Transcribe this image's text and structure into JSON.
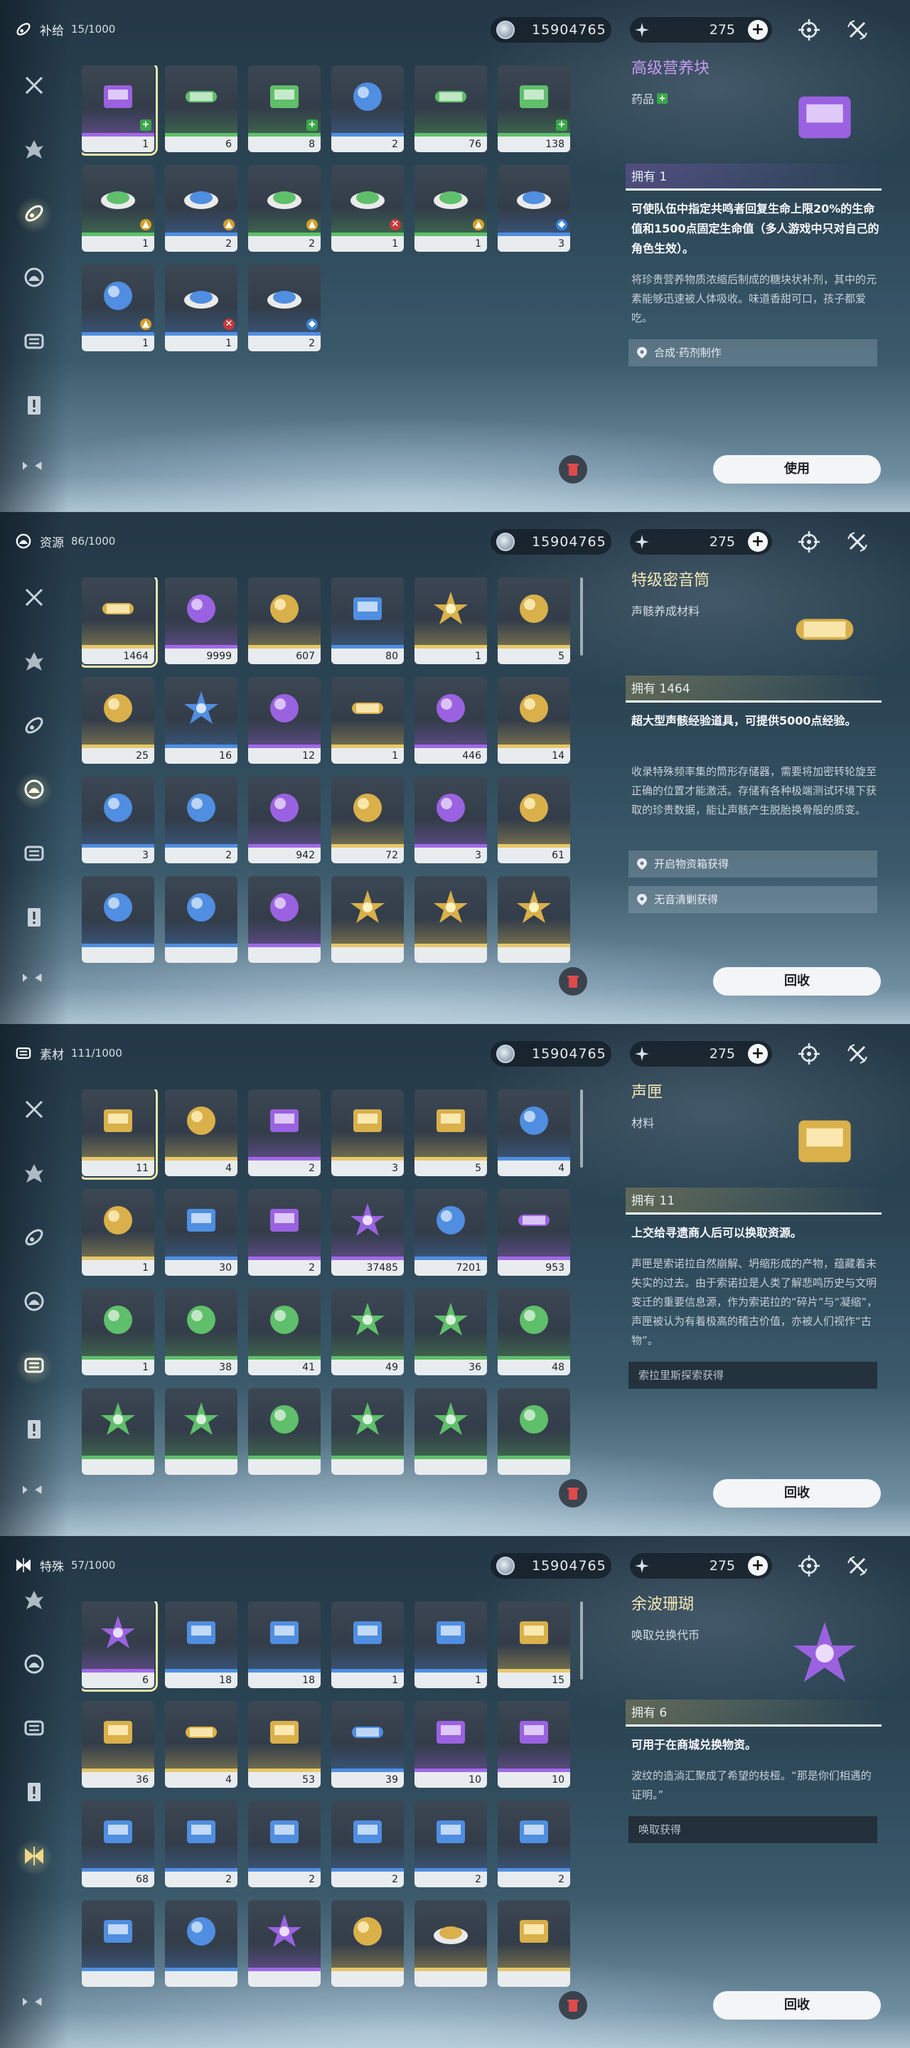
{
  "colors": {
    "accent_gold": "#f0e6a8",
    "rarity_green": "#5fbf6a",
    "rarity_blue": "#4f8ee0",
    "rarity_purple": "#a06ae6",
    "rarity_gold": "#e6c86a"
  },
  "panels": [
    {
      "category": "补给",
      "count": "15/1000",
      "currency": "15904765",
      "energy": "275",
      "items": [
        {
          "count": "1",
          "rarity": "purple",
          "badge": "heal",
          "icon": "nutrition-block-icon"
        },
        {
          "count": "6",
          "rarity": "green",
          "badge": "",
          "icon": "spray-canister-icon"
        },
        {
          "count": "8",
          "rarity": "green",
          "badge": "heal",
          "icon": "nutrition-block-icon"
        },
        {
          "count": "2",
          "rarity": "blue",
          "badge": "",
          "icon": "supply-bag-icon"
        },
        {
          "count": "76",
          "rarity": "green",
          "badge": "",
          "icon": "spray-canister-icon"
        },
        {
          "count": "138",
          "rarity": "green",
          "badge": "heal",
          "icon": "nutrition-block-icon"
        },
        {
          "count": "1",
          "rarity": "green",
          "badge": "buff",
          "icon": "dish-icon"
        },
        {
          "count": "2",
          "rarity": "blue",
          "badge": "buff",
          "icon": "skewer-icon"
        },
        {
          "count": "2",
          "rarity": "green",
          "badge": "buff",
          "icon": "soup-bowl-icon"
        },
        {
          "count": "1",
          "rarity": "green",
          "badge": "atk",
          "icon": "roast-icon"
        },
        {
          "count": "1",
          "rarity": "green",
          "badge": "buff",
          "icon": "fried-rice-icon"
        },
        {
          "count": "3",
          "rarity": "blue",
          "badge": "def",
          "icon": "pizza-icon"
        },
        {
          "count": "1",
          "rarity": "blue",
          "badge": "buff",
          "icon": "ice-cream-icon"
        },
        {
          "count": "1",
          "rarity": "blue",
          "badge": "atk",
          "icon": "sandwich-icon"
        },
        {
          "count": "2",
          "rarity": "blue",
          "badge": "def",
          "icon": "pastry-icon"
        }
      ],
      "detail": {
        "title": "高级营养块",
        "type": "药品",
        "own": "拥有 1",
        "desc": "可使队伍中指定共鸣者回复生命上限20%的生命值和1500点固定生命值（多人游戏中只对自己的角色生效）。",
        "lore": "将珍贵营养物质浓缩后制成的糖块状补剂，其中的元素能够迅速被人体吸收。味道香甜可口，孩子都爱吃。",
        "sources": [
          "合成·药剂制作"
        ],
        "button": "使用"
      }
    },
    {
      "category": "资源",
      "count": "86/1000",
      "currency": "15904765",
      "energy": "275",
      "items": [
        {
          "count": "1464",
          "rarity": "gold",
          "icon": "sonance-canister-icon"
        },
        {
          "count": "9999",
          "rarity": "purple",
          "icon": "cube-crystal-icon"
        },
        {
          "count": "607",
          "rarity": "gold",
          "icon": "cube-crystal-icon"
        },
        {
          "count": "80",
          "rarity": "blue",
          "icon": "device-icon"
        },
        {
          "count": "1",
          "rarity": "gold",
          "icon": "star-shard-icon"
        },
        {
          "count": "5",
          "rarity": "gold",
          "icon": "orb-icon"
        },
        {
          "count": "25",
          "rarity": "gold",
          "icon": "lattice-icon"
        },
        {
          "count": "16",
          "rarity": "blue",
          "icon": "shell-icon"
        },
        {
          "count": "12",
          "rarity": "purple",
          "icon": "mech-part-icon"
        },
        {
          "count": "1",
          "rarity": "gold",
          "icon": "scroll-tube-icon"
        },
        {
          "count": "446",
          "rarity": "purple",
          "icon": "vial-icon"
        },
        {
          "count": "14",
          "rarity": "gold",
          "icon": "ember-orb-icon"
        },
        {
          "count": "3",
          "rarity": "blue",
          "icon": "wing-crystal-icon"
        },
        {
          "count": "2",
          "rarity": "blue",
          "icon": "crystal-cluster-icon"
        },
        {
          "count": "942",
          "rarity": "purple",
          "icon": "cube-crystal-icon"
        },
        {
          "count": "72",
          "rarity": "gold",
          "icon": "orb-icon"
        },
        {
          "count": "3",
          "rarity": "purple",
          "icon": "ring-icon"
        },
        {
          "count": "61",
          "rarity": "gold",
          "icon": "lattice-icon"
        },
        {
          "count": "",
          "rarity": "blue",
          "icon": "ice-shard-icon"
        },
        {
          "count": "",
          "rarity": "blue",
          "icon": "husk-icon"
        },
        {
          "count": "",
          "rarity": "purple",
          "icon": "mask-icon"
        },
        {
          "count": "",
          "rarity": "gold",
          "icon": "burst-icon"
        },
        {
          "count": "",
          "rarity": "gold",
          "icon": "burst-icon"
        },
        {
          "count": "",
          "rarity": "gold",
          "icon": "burst-icon"
        }
      ],
      "detail": {
        "title": "特级密音筒",
        "type": "声骸养成材料",
        "own": "拥有 1464",
        "desc": "超大型声骸经验道具，可提供5000点经验。",
        "lore": "收录特殊频率集的筒形存储器，需要将加密转轮旋至正确的位置才能激活。存储有各种极端测试环境下获取的珍贵数据，能让声骸产生脱胎换骨般的质变。",
        "sources": [
          "开启物资箱获得",
          "无音清剿获得"
        ],
        "button": "回收"
      }
    },
    {
      "category": "素材",
      "count": "111/1000",
      "currency": "15904765",
      "energy": "275",
      "items": [
        {
          "count": "11",
          "rarity": "gold",
          "icon": "sound-box-icon"
        },
        {
          "count": "4",
          "rarity": "gold",
          "icon": "flame-icon"
        },
        {
          "count": "2",
          "rarity": "purple",
          "icon": "card-icon"
        },
        {
          "count": "3",
          "rarity": "gold",
          "icon": "sound-box-icon"
        },
        {
          "count": "5",
          "rarity": "gold",
          "icon": "sound-box-icon"
        },
        {
          "count": "4",
          "rarity": "blue",
          "icon": "drop-icon"
        },
        {
          "count": "1",
          "rarity": "gold",
          "icon": "amber-icon"
        },
        {
          "count": "30",
          "rarity": "blue",
          "icon": "stone-block-icon"
        },
        {
          "count": "2",
          "rarity": "purple",
          "icon": "ore-slab-icon"
        },
        {
          "count": "37485",
          "rarity": "purple",
          "icon": "feather-crystal-icon"
        },
        {
          "count": "7201",
          "rarity": "blue",
          "icon": "rock-ball-icon"
        },
        {
          "count": "953",
          "rarity": "purple",
          "icon": "capsule-icon"
        },
        {
          "count": "1",
          "rarity": "green",
          "icon": "prism-icon"
        },
        {
          "count": "38",
          "rarity": "green",
          "icon": "seeds-icon"
        },
        {
          "count": "41",
          "rarity": "green",
          "icon": "berry-icon"
        },
        {
          "count": "49",
          "rarity": "green",
          "icon": "blue-flower-icon"
        },
        {
          "count": "36",
          "rarity": "green",
          "icon": "white-sprout-icon"
        },
        {
          "count": "48",
          "rarity": "green",
          "icon": "lantern-fruit-icon"
        },
        {
          "count": "",
          "rarity": "green",
          "icon": "lily-icon"
        },
        {
          "count": "",
          "rarity": "green",
          "icon": "red-flower-icon"
        },
        {
          "count": "",
          "rarity": "green",
          "icon": "mushroom-icon"
        },
        {
          "count": "",
          "rarity": "green",
          "icon": "daisy-icon"
        },
        {
          "count": "",
          "rarity": "green",
          "icon": "coral-weed-icon"
        },
        {
          "count": "",
          "rarity": "green",
          "icon": "pod-icon"
        }
      ],
      "detail": {
        "title": "声匣",
        "type": "材料",
        "own": "拥有 11",
        "desc": "上交给寻遗商人后可以换取资源。",
        "lore": "声匣是索诺拉自然崩解、坍缩形成的产物，蕴藏着未失实的过去。由于索诺拉是人类了解悲鸣历史与文明变迁的重要信息源，作为索诺拉的“碎片”与“凝缩”，声匣被认为有着极高的稽古价值，亦被人们视作“古物”。",
        "sources": [
          "索拉里斯探索获得"
        ],
        "button": "回收"
      }
    },
    {
      "category": "特殊",
      "count": "57/1000",
      "currency": "15904765",
      "energy": "275",
      "items": [
        {
          "count": "6",
          "rarity": "purple",
          "icon": "coral-icon"
        },
        {
          "count": "18",
          "rarity": "blue",
          "icon": "supply-crate-icon"
        },
        {
          "count": "18",
          "rarity": "blue",
          "icon": "supply-crate-icon"
        },
        {
          "count": "1",
          "rarity": "blue",
          "icon": "supply-crate-icon"
        },
        {
          "count": "1",
          "rarity": "blue",
          "icon": "supply-crate-icon"
        },
        {
          "count": "15",
          "rarity": "gold",
          "icon": "gold-crate-icon"
        },
        {
          "count": "36",
          "rarity": "gold",
          "icon": "gold-crate-icon"
        },
        {
          "count": "4",
          "rarity": "gold",
          "icon": "gold-capsule-icon"
        },
        {
          "count": "53",
          "rarity": "gold",
          "icon": "machine-icon"
        },
        {
          "count": "39",
          "rarity": "blue",
          "icon": "canister-icon"
        },
        {
          "count": "10",
          "rarity": "purple",
          "icon": "red-crate-icon"
        },
        {
          "count": "10",
          "rarity": "purple",
          "icon": "red-crate-icon"
        },
        {
          "count": "68",
          "rarity": "blue",
          "icon": "supply-crate-icon"
        },
        {
          "count": "2",
          "rarity": "blue",
          "icon": "supply-crate-icon"
        },
        {
          "count": "2",
          "rarity": "blue",
          "icon": "supply-crate-icon"
        },
        {
          "count": "2",
          "rarity": "blue",
          "icon": "supply-crate-icon"
        },
        {
          "count": "2",
          "rarity": "blue",
          "icon": "supply-crate-icon"
        },
        {
          "count": "2",
          "rarity": "blue",
          "icon": "supply-crate-icon"
        },
        {
          "count": "",
          "rarity": "blue",
          "icon": "supply-crate-icon"
        },
        {
          "count": "",
          "rarity": "blue",
          "icon": "circuit-board-icon"
        },
        {
          "count": "",
          "rarity": "purple",
          "icon": "feather-icon"
        },
        {
          "count": "",
          "rarity": "gold",
          "icon": "jar-icon"
        },
        {
          "count": "",
          "rarity": "gold",
          "icon": "cake-icon"
        },
        {
          "count": "",
          "rarity": "gold",
          "icon": "cards-icon"
        }
      ],
      "detail": {
        "title": "余波珊瑚",
        "type": "唤取兑换代币",
        "own": "拥有 6",
        "desc": "可用于在商城兑换物资。",
        "lore": "波纹的造淌汇聚成了希望的枝桠。“那是你们相遇的证明。”",
        "sources": [
          "唤取获得"
        ],
        "button": "回收"
      }
    }
  ]
}
